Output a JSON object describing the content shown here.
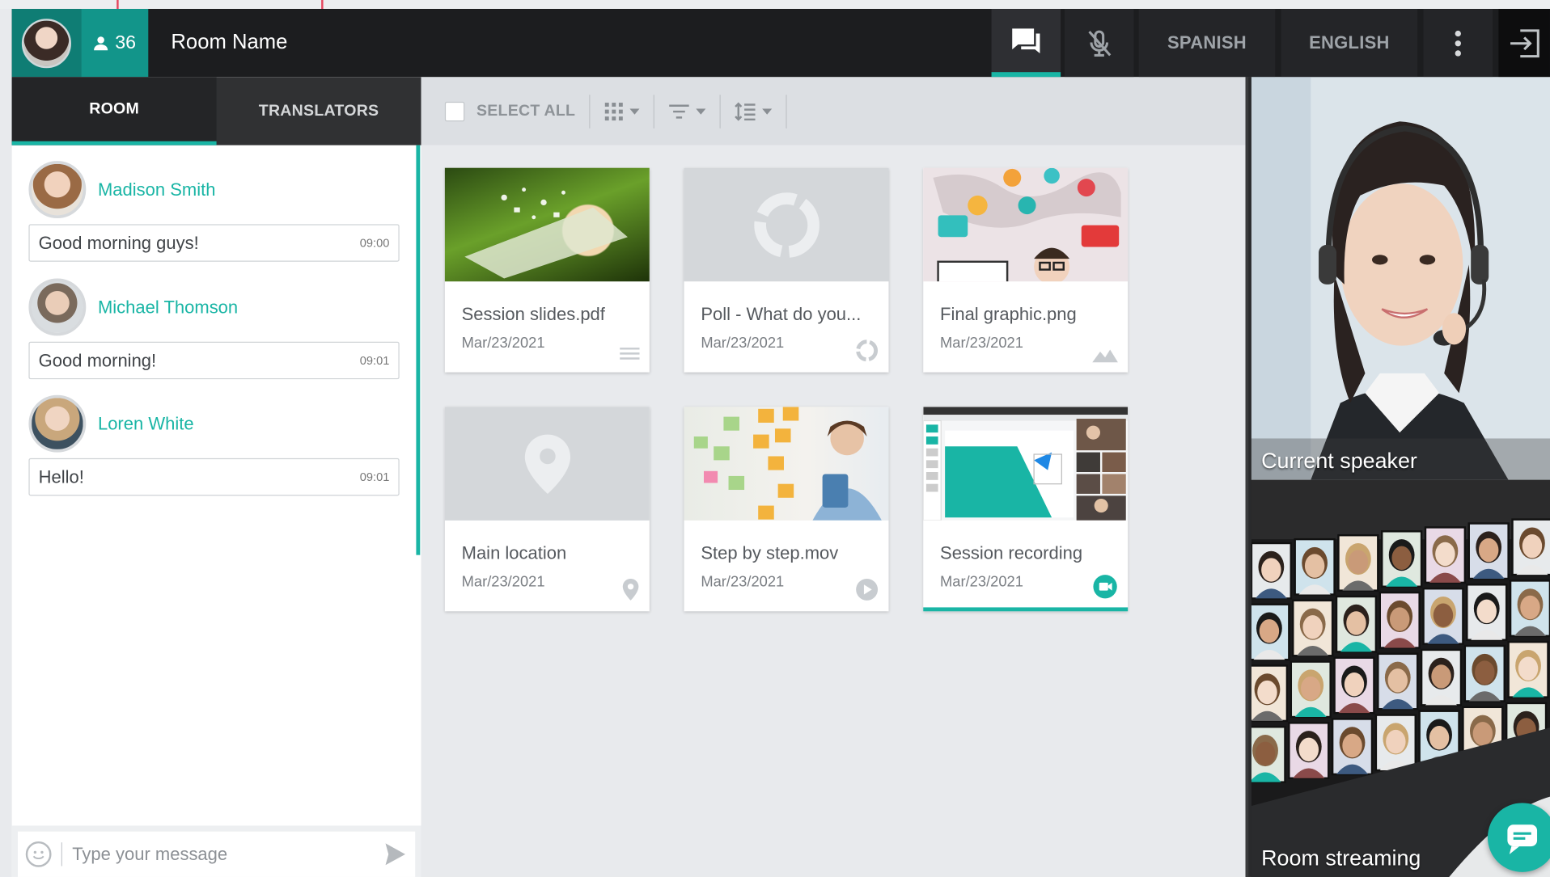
{
  "header": {
    "participant_count": "36",
    "room_name": "Room Name",
    "buttons": {
      "spanish": "SPANISH",
      "english": "ENGLISH"
    },
    "accent": "#19b5a5"
  },
  "left_panel": {
    "tabs": [
      "ROOM",
      "TRANSLATORS"
    ],
    "messages": [
      {
        "name": "Madison Smith",
        "text": "Good morning guys!",
        "time": "09:00"
      },
      {
        "name": "Michael Thomson",
        "text": "Good morning!",
        "time": "09:01"
      },
      {
        "name": "Loren White",
        "text": "Hello!",
        "time": "09:01"
      }
    ],
    "input_placeholder": "Type your message"
  },
  "toolbar": {
    "select_all": "SELECT ALL",
    "tools": [
      "grid-view-icon",
      "filter-icon",
      "sort-icon"
    ]
  },
  "files": [
    {
      "name": "Session slides.pdf",
      "date": "Mar/23/2021",
      "icon": "document-icon"
    },
    {
      "name": "Poll - What do you...",
      "date": "Mar/23/2021",
      "icon": "poll-icon"
    },
    {
      "name": "Final graphic.png",
      "date": "Mar/23/2021",
      "icon": "image-icon"
    },
    {
      "name": "Main location",
      "date": "Mar/23/2021",
      "icon": "location-icon"
    },
    {
      "name": "Step by step.mov",
      "date": "Mar/23/2021",
      "icon": "play-icon"
    },
    {
      "name": "Session recording",
      "date": "Mar/23/2021",
      "icon": "recording-icon",
      "selected": true
    }
  ],
  "right_panel": {
    "current_speaker_label": "Current speaker",
    "room_streaming_label": "Room streaming"
  }
}
